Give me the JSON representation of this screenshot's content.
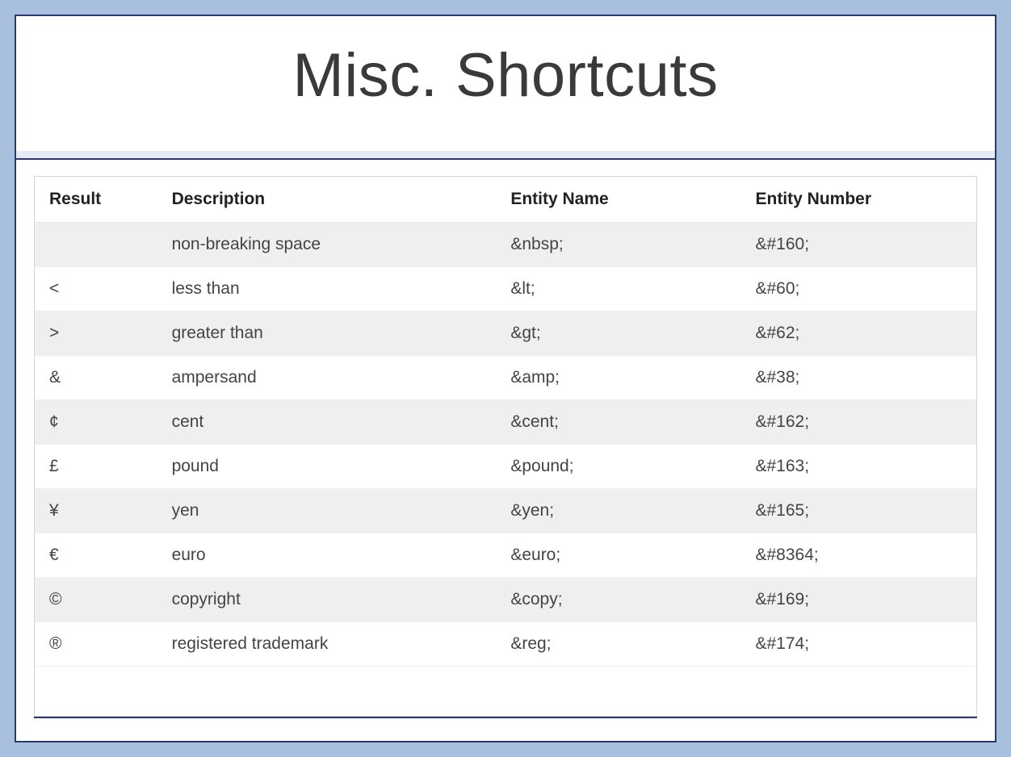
{
  "title": "Misc. Shortcuts",
  "table": {
    "headers": {
      "result": "Result",
      "description": "Description",
      "entity_name": "Entity Name",
      "entity_number": "Entity Number"
    },
    "rows": [
      {
        "result": "",
        "description": "non-breaking space",
        "entity_name": "&nbsp;",
        "entity_number": "&#160;"
      },
      {
        "result": "<",
        "description": "less than",
        "entity_name": "&lt;",
        "entity_number": "&#60;"
      },
      {
        "result": ">",
        "description": "greater than",
        "entity_name": "&gt;",
        "entity_number": "&#62;"
      },
      {
        "result": "&",
        "description": "ampersand",
        "entity_name": "&amp;",
        "entity_number": "&#38;"
      },
      {
        "result": "¢",
        "description": "cent",
        "entity_name": "&cent;",
        "entity_number": "&#162;"
      },
      {
        "result": "£",
        "description": "pound",
        "entity_name": "&pound;",
        "entity_number": "&#163;"
      },
      {
        "result": "¥",
        "description": "yen",
        "entity_name": "&yen;",
        "entity_number": "&#165;"
      },
      {
        "result": "€",
        "description": "euro",
        "entity_name": "&euro;",
        "entity_number": "&#8364;"
      },
      {
        "result": "©",
        "description": "copyright",
        "entity_name": "&copy;",
        "entity_number": "&#169;"
      },
      {
        "result": "®",
        "description": "registered trademark",
        "entity_name": "&reg;",
        "entity_number": "&#174;"
      }
    ]
  },
  "chart_data": {
    "type": "table",
    "title": "Misc. Shortcuts",
    "columns": [
      "Result",
      "Description",
      "Entity Name",
      "Entity Number"
    ],
    "rows": [
      [
        "",
        "non-breaking space",
        "&nbsp;",
        "&#160;"
      ],
      [
        "<",
        "less than",
        "&lt;",
        "&#60;"
      ],
      [
        ">",
        "greater than",
        "&gt;",
        "&#62;"
      ],
      [
        "&",
        "ampersand",
        "&amp;",
        "&#38;"
      ],
      [
        "¢",
        "cent",
        "&cent;",
        "&#162;"
      ],
      [
        "£",
        "pound",
        "&pound;",
        "&#163;"
      ],
      [
        "¥",
        "yen",
        "&yen;",
        "&#165;"
      ],
      [
        "€",
        "euro",
        "&euro;",
        "&#8364;"
      ],
      [
        "©",
        "copyright",
        "&copy;",
        "&#169;"
      ],
      [
        "®",
        "registered trademark",
        "&reg;",
        "&#174;"
      ]
    ]
  }
}
